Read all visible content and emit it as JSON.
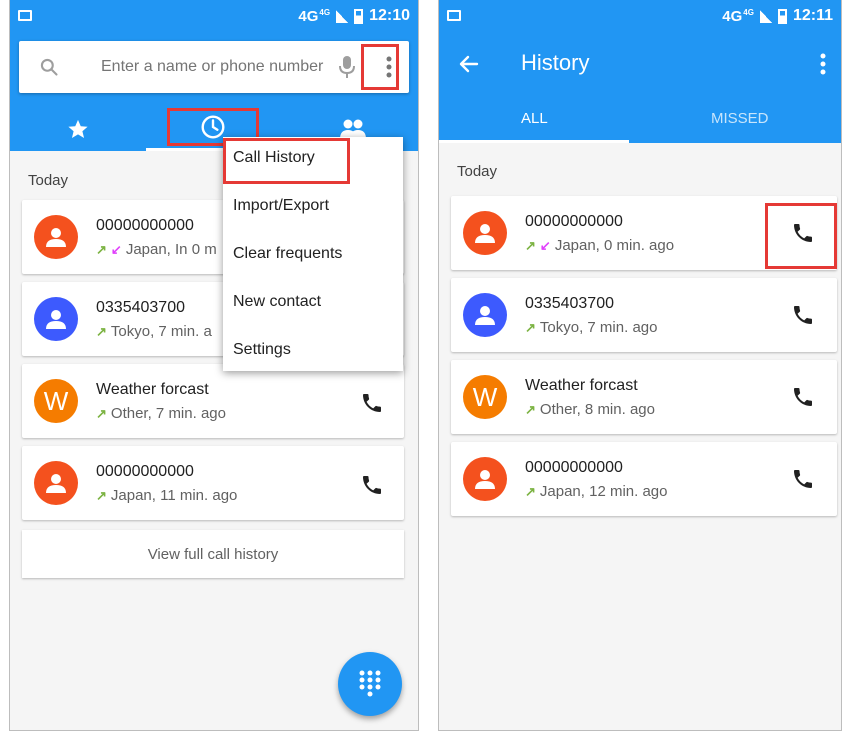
{
  "left_screen": {
    "status": {
      "network": "4G",
      "network_sup": "4G",
      "time": "12:10"
    },
    "search": {
      "placeholder": "Enter a name or phone number"
    },
    "section_label": "Today",
    "calls": [
      {
        "avatar": "person",
        "avatar_color": "#f4511e",
        "name": "00000000000",
        "detail": "Japan, In 0 m",
        "call_type": "outgoing-incoming"
      },
      {
        "avatar": "person",
        "avatar_color": "#3d5afe",
        "name": "0335403700",
        "detail": "Tokyo, 7 min. a",
        "call_type": "outgoing"
      },
      {
        "avatar": "W",
        "avatar_color": "#f57c00",
        "name": "Weather forcast",
        "detail": "Other, 7 min. ago",
        "call_type": "outgoing"
      },
      {
        "avatar": "person",
        "avatar_color": "#f4511e",
        "name": "00000000000",
        "detail": "Japan, 11 min. ago",
        "call_type": "outgoing"
      }
    ],
    "view_all_label": "View full call history",
    "menu": {
      "items": [
        "Call History",
        "Import/Export",
        "Clear frequents",
        "New contact",
        "Settings"
      ]
    }
  },
  "right_screen": {
    "status": {
      "network": "4G",
      "network_sup": "4G",
      "time": "12:11"
    },
    "title": "History",
    "tabs": [
      "ALL",
      "MISSED"
    ],
    "section_label": "Today",
    "calls": [
      {
        "avatar": "person",
        "avatar_color": "#f4511e",
        "name": "00000000000",
        "detail": "Japan, 0 min. ago",
        "call_type": "outgoing-incoming"
      },
      {
        "avatar": "person",
        "avatar_color": "#3d5afe",
        "name": "0335403700",
        "detail": "Tokyo, 7 min. ago",
        "call_type": "outgoing"
      },
      {
        "avatar": "W",
        "avatar_color": "#f57c00",
        "name": "Weather forcast",
        "detail": "Other, 8 min. ago",
        "call_type": "outgoing"
      },
      {
        "avatar": "person",
        "avatar_color": "#f4511e",
        "name": "00000000000",
        "detail": "Japan, 12 min. ago",
        "call_type": "outgoing"
      }
    ]
  },
  "colors": {
    "primary": "#2196f3",
    "highlight": "#e53935"
  }
}
